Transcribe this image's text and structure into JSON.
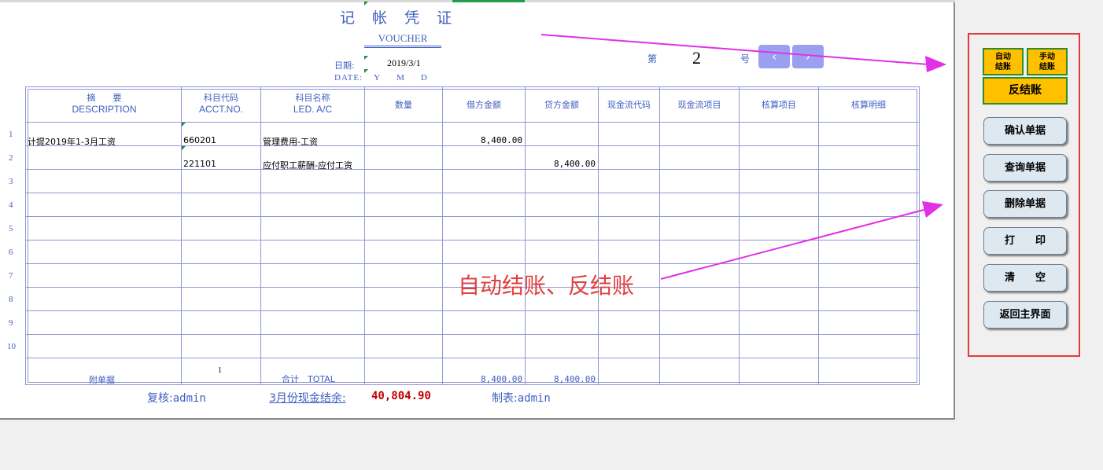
{
  "title_chars": [
    "记",
    "帐",
    "凭",
    "证"
  ],
  "voucher_label": "VOUCHER",
  "date": {
    "label": "日期:",
    "value": "2019/3/1",
    "date_label": "DATE:",
    "y": "Y",
    "m": "M",
    "d": "D"
  },
  "number": {
    "prefix": "第",
    "value": "2",
    "suffix": "号"
  },
  "nav": {
    "prev": "‹",
    "next": "›"
  },
  "columns": {
    "desc_cn": "摘　　要",
    "desc_en": "DESCRIPTION",
    "acct_cn": "科目代码",
    "acct_en": "ACCT.NO.",
    "led_cn": "科目名称",
    "led_en": "LED. A/C",
    "qty": "数量",
    "debit": "借方金额",
    "credit": "贷方金额",
    "cf_code": "现金流代码",
    "cf_item": "现金流项目",
    "acc_item": "核算项目",
    "acc_detail": "核算明细"
  },
  "row_numbers": [
    "1",
    "2",
    "3",
    "4",
    "5",
    "6",
    "7",
    "8",
    "9",
    "10"
  ],
  "rows": [
    {
      "desc": "计提2019年1-3月工资",
      "acct": "660201",
      "led": "管理费用-工资",
      "debit": "8,400.00",
      "credit": ""
    },
    {
      "desc": "",
      "acct": "221101",
      "led": "应付职工薪酬-应付工资",
      "debit": "",
      "credit": "8,400.00"
    }
  ],
  "footer": {
    "attach_label": "附单据",
    "attach_count": "1",
    "total_label": "合计　TOTAL",
    "total_debit": "8,400.00",
    "total_credit": "8,400.00"
  },
  "bottom": {
    "reviewer_label": "复核:",
    "reviewer": "admin",
    "cash_label": "3月份现金结余:",
    "cash_value": "40,804.90",
    "maker_label": "制表:",
    "maker": "admin"
  },
  "annotation": "自动结账、反结账",
  "panel": {
    "auto_close": "自动结账",
    "manual_close": "手动结账",
    "reverse_close": "反结账",
    "confirm": "确认单据",
    "query": "查询单据",
    "delete": "删除单据",
    "print": "打　　印",
    "clear": "清　　空",
    "back": "返回主界面"
  },
  "colors": {
    "label_blue": "#3f5fbf",
    "grid_line": "#8f96d6",
    "nav_button": "#9aa0ef",
    "panel_border": "#e23b3b",
    "yellow_button": "#ffc000",
    "annotation_red": "#e04040",
    "arrow_magenta": "#e030e8",
    "cash_red": "#c00000"
  }
}
